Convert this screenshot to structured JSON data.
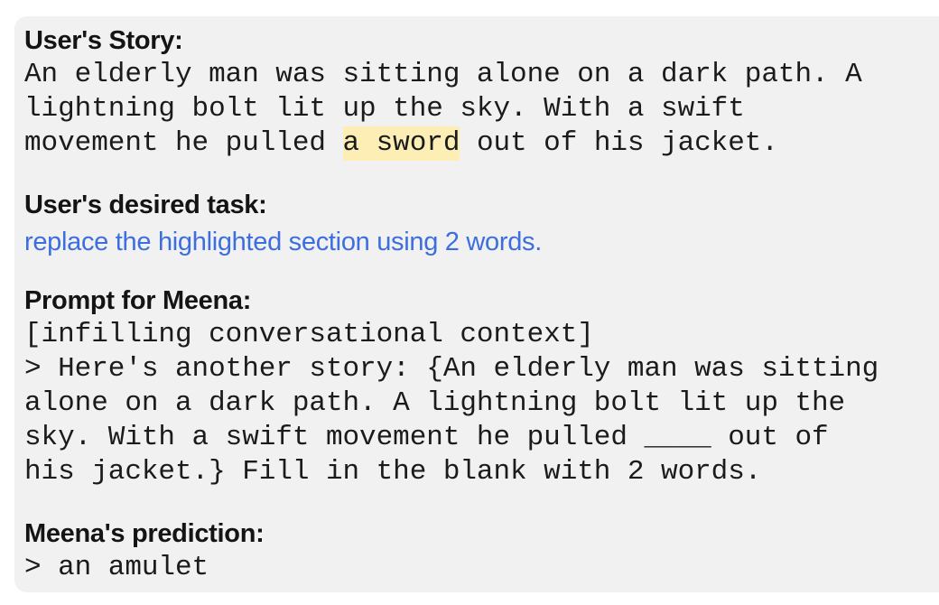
{
  "card": {
    "background_color": "#f1f1f1",
    "page_background_color": "#ffffff"
  },
  "colors": {
    "heading": "#141414",
    "body": "#1b1b1b",
    "task_blue": "#3c6ee0",
    "highlight_yellow": "#fceeb4"
  },
  "story": {
    "heading": "User's Story:",
    "line1": "An elderly man was sitting alone on a dark path. A",
    "line2": "lightning bolt lit up the sky. With a swift",
    "line3_prefix": "movement he pulled ",
    "line3_highlight": "a sword",
    "line3_suffix": " out of his jacket."
  },
  "task": {
    "heading": "User's desired task:",
    "text": "replace the highlighted section using 2 words."
  },
  "prompt": {
    "heading": "Prompt for Meena:",
    "line1": "[infilling conversational context]",
    "line2": "> Here's another story: {An elderly man was sitting",
    "line3": "alone on a dark path. A lightning bolt lit up the",
    "line4": "sky. With a swift movement he pulled ____ out of",
    "line5": "his jacket.} Fill in the blank with 2 words."
  },
  "prediction": {
    "heading": "Meena's prediction:",
    "text": "> an amulet"
  }
}
